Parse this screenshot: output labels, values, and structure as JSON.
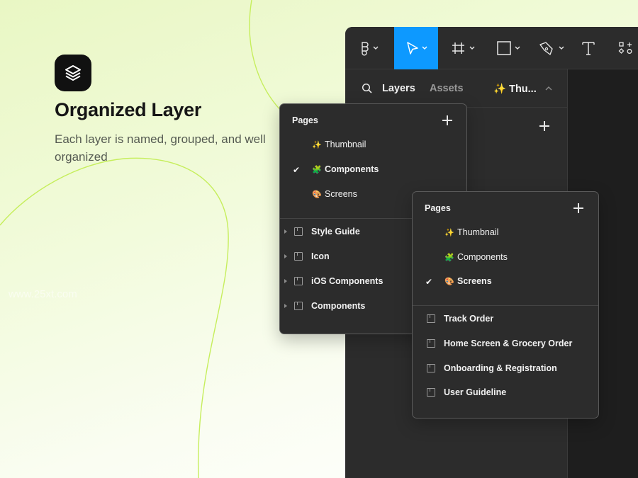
{
  "hero": {
    "title": "Organized Layer",
    "description": "Each layer is named, grouped, and well organized",
    "watermark": "www.25xt.com"
  },
  "toolbar": {
    "tools": [
      {
        "name": "figma-menu",
        "icon": "figma-logo-icon",
        "has_chevron": true
      },
      {
        "name": "move",
        "icon": "pointer-icon",
        "has_chevron": true,
        "active": true
      },
      {
        "name": "frame",
        "icon": "frame-hash-icon",
        "has_chevron": true
      },
      {
        "name": "shape",
        "icon": "rectangle-icon",
        "has_chevron": true
      },
      {
        "name": "pen",
        "icon": "pen-icon",
        "has_chevron": true
      },
      {
        "name": "text",
        "icon": "text-icon",
        "label": "T"
      },
      {
        "name": "components",
        "icon": "components-icon"
      }
    ],
    "active_color": "#0d99ff"
  },
  "panel": {
    "tabs": {
      "layers": "Layers",
      "assets": "Assets",
      "current_page": "✨ Thu..."
    }
  },
  "pages_panel_1": {
    "title": "Pages",
    "pages": [
      {
        "emoji": "✨",
        "label": "Thumbnail",
        "checked": false
      },
      {
        "emoji": "🧩",
        "label": "Components",
        "checked": true
      },
      {
        "emoji": "🎨",
        "label": "Screens",
        "checked": false
      }
    ],
    "layers": [
      {
        "label": "Style Guide"
      },
      {
        "label": "Icon"
      },
      {
        "label": "iOS Components"
      },
      {
        "label": "Components"
      }
    ]
  },
  "pages_panel_2": {
    "title": "Pages",
    "pages": [
      {
        "emoji": "✨",
        "label": "Thumbnail",
        "checked": false
      },
      {
        "emoji": "🧩",
        "label": "Components",
        "checked": false
      },
      {
        "emoji": "🎨",
        "label": "Screens",
        "checked": true
      }
    ],
    "layers": [
      {
        "label": "Track Order"
      },
      {
        "label": "Home Screen & Grocery Order"
      },
      {
        "label": "Onboarding & Registration"
      },
      {
        "label": "User Guideline"
      }
    ]
  },
  "colors": {
    "background_accent": "#e9f7c4",
    "curve": "#c8f066",
    "editor_bg": "#2c2c2c",
    "canvas_bg": "#1e1e1e"
  }
}
